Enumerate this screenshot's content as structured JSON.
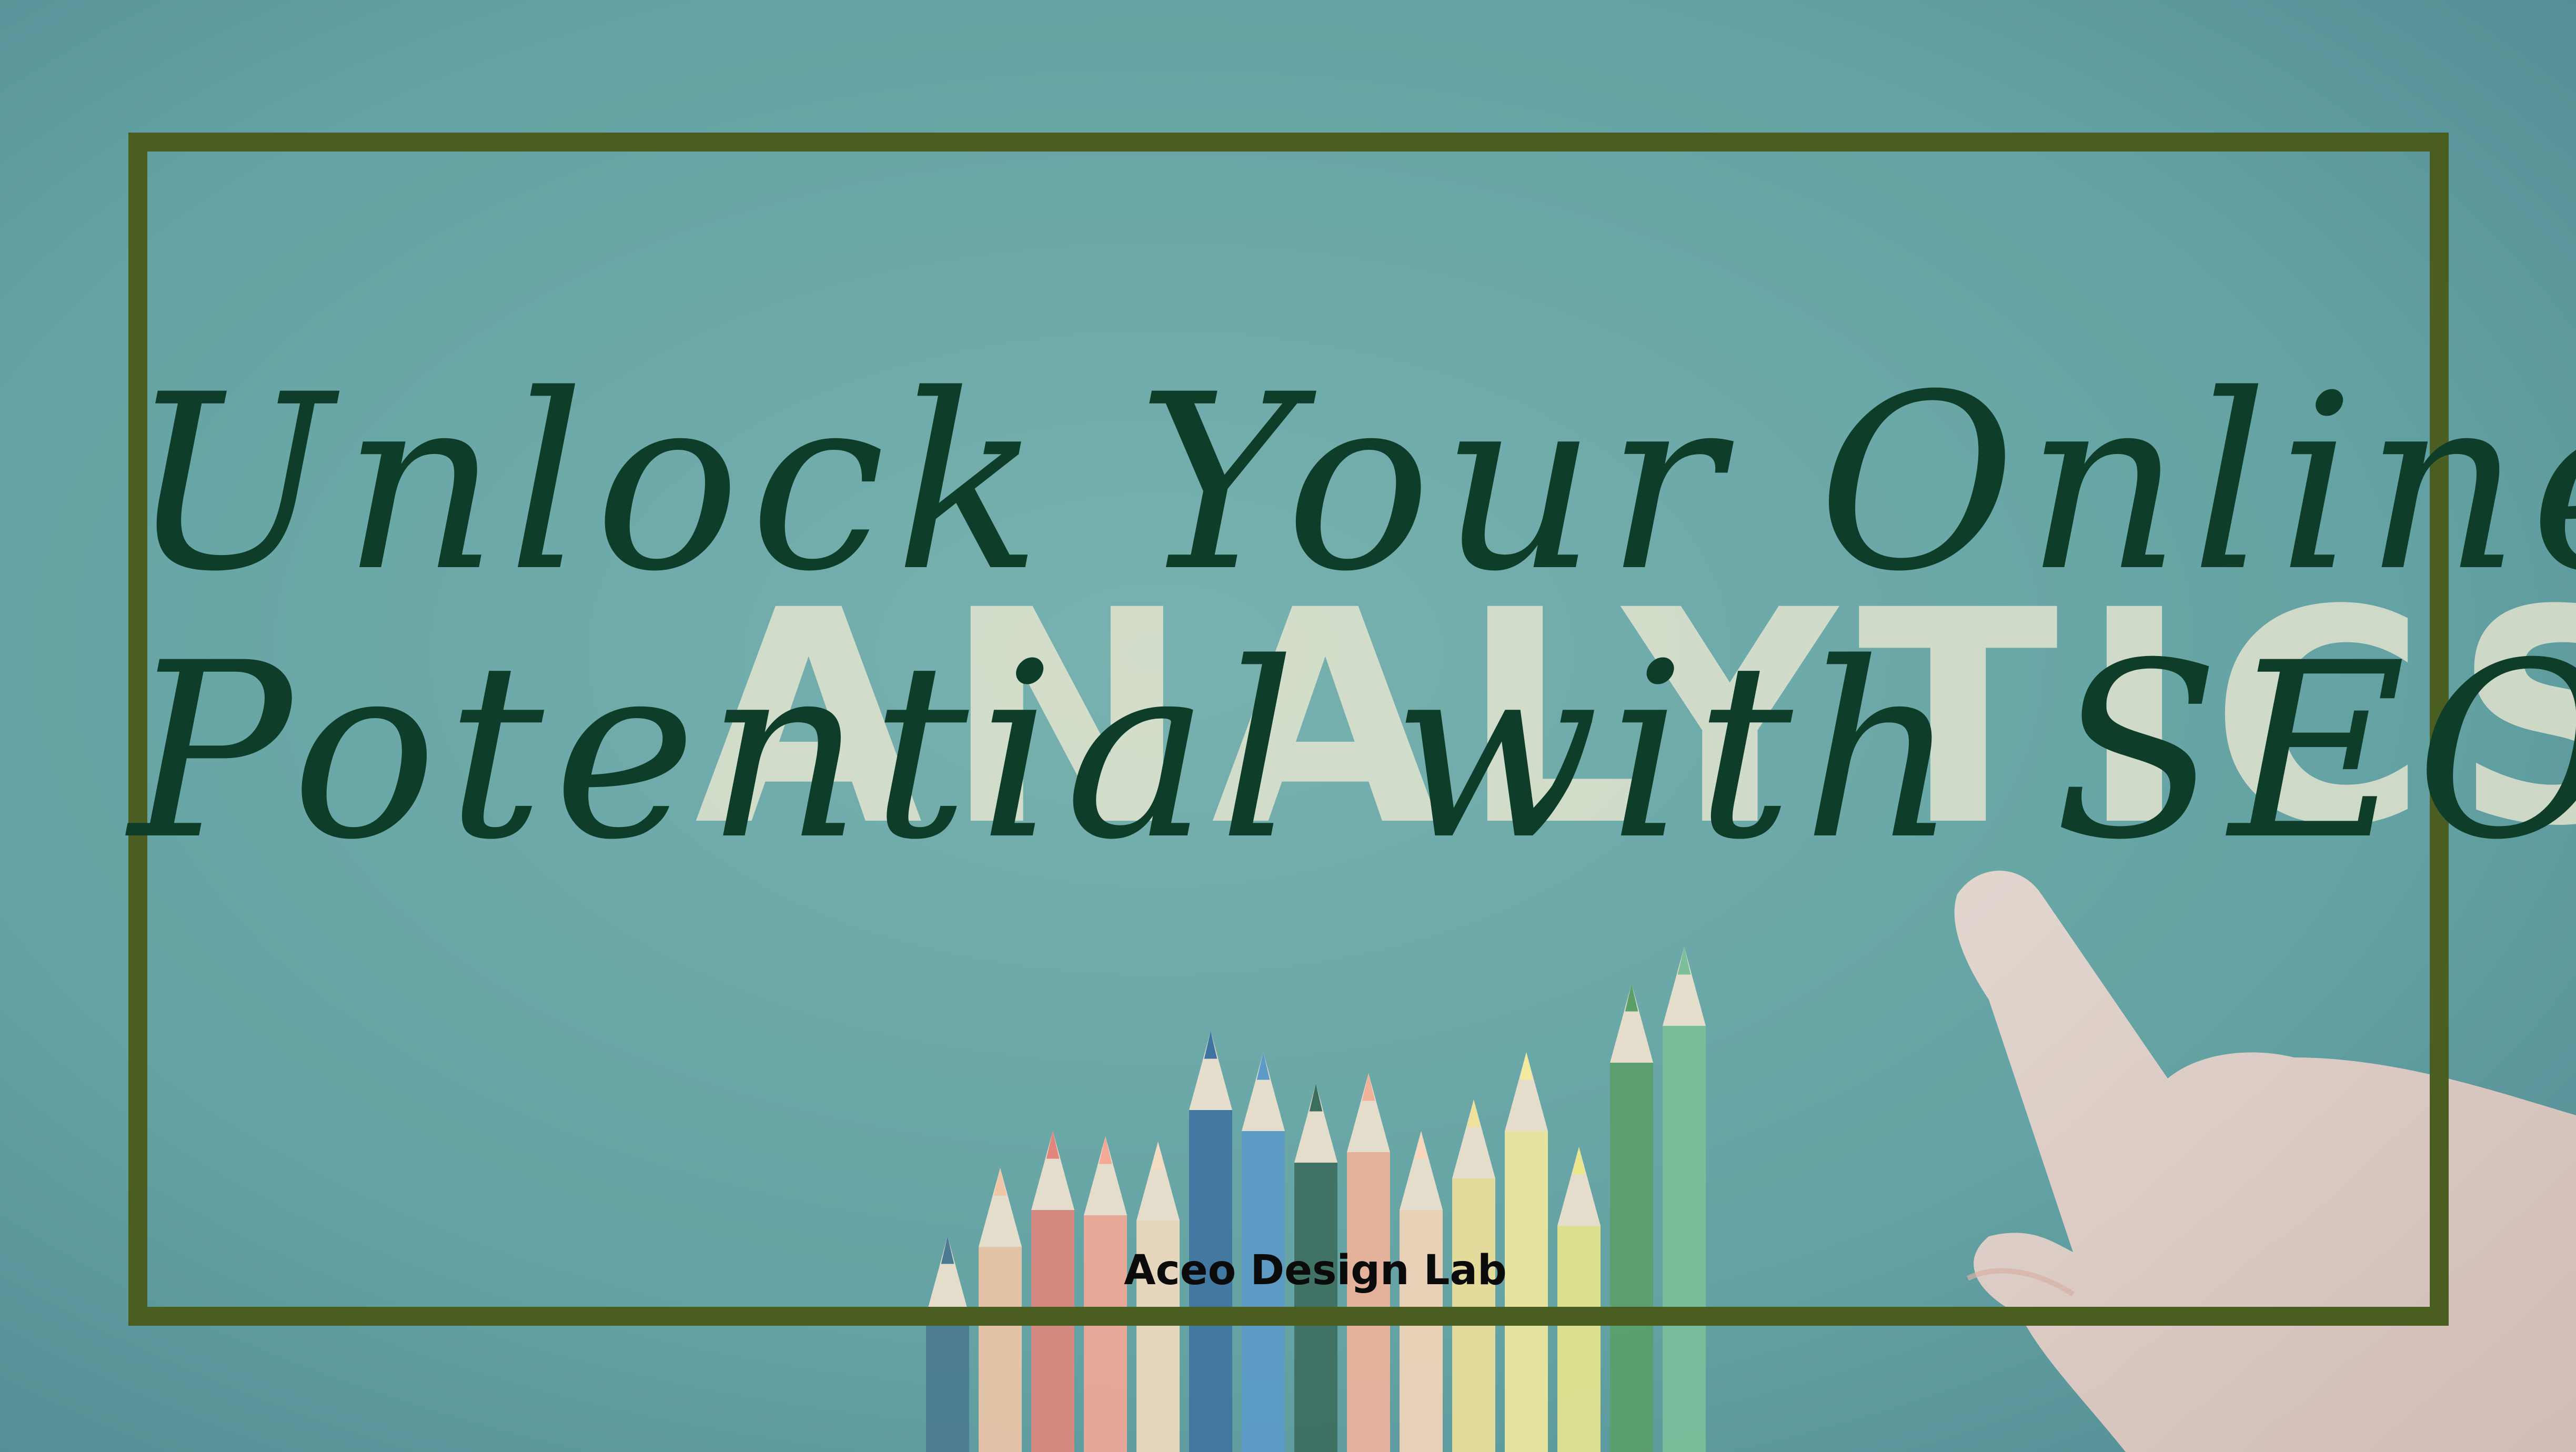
{
  "headline": {
    "line1": "Unlock Your Online",
    "line2": "Potential with SEO"
  },
  "background_word": "ANALYTICS",
  "credit": "Aceo Design Lab",
  "colors": {
    "background": "#5f9c9e",
    "frame": "#4b5e22",
    "headline_text": "#0e3e2a",
    "letters": "#f2ecd4",
    "credit_text": "#0b0b0b"
  },
  "pencil_colors": [
    "#4c7a92",
    "#f0c7a6",
    "#e0867c",
    "#f4a896",
    "#f4dcc0",
    "#3f73a0",
    "#5c9ac8",
    "#3c6e5e",
    "#f2b29a",
    "#f7d6ba",
    "#efe19a",
    "#f3ea9e",
    "#e9e68c",
    "#5aa068",
    "#7bc09a"
  ],
  "icons": [
    "pencil-icon",
    "hand-icon"
  ]
}
